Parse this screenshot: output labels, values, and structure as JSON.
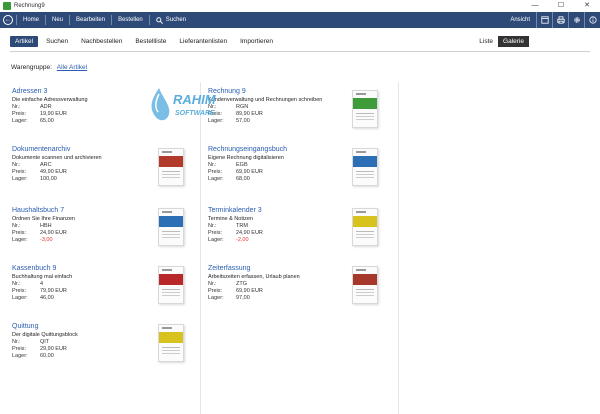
{
  "window": {
    "title": "Rechnung9",
    "controls": [
      "—",
      "☐",
      "✕"
    ]
  },
  "toolbar": {
    "items": [
      "Home",
      "Neu",
      "Bearbeiten",
      "Bestellen"
    ],
    "search_label": "Suchen",
    "view_label": "Ansicht"
  },
  "tabs": [
    "Artikel",
    "Suchen",
    "Nachbestellen",
    "Bestellliste",
    "Lieferantenlisten",
    "Importieren"
  ],
  "view": {
    "list": "Liste",
    "gallery": "Galerie"
  },
  "group": {
    "label": "Warengruppe:",
    "value": "Alle Artikel"
  },
  "watermark": {
    "text1": "RAHIM",
    "text2": "SOFTWARE"
  },
  "labels": {
    "nr": "Nr.:",
    "preis": "Preis:",
    "lager": "Lager:"
  },
  "products": [
    {
      "name": "Adressen 3",
      "desc": "Die einfache Adressverwaltung",
      "nr": "ADR",
      "preis": "19,90 EUR",
      "lager": "65,00",
      "neg": false,
      "color": ""
    },
    {
      "name": "Dokumentenarchiv",
      "desc": "Dokumente scannen und archivieren",
      "nr": "ARC",
      "preis": "49,90 EUR",
      "lager": "100,00",
      "neg": false,
      "color": "#b23a2a"
    },
    {
      "name": "Haushaltsbuch 7",
      "desc": "Ordnen Sie Ihre Finanzen",
      "nr": "HBH",
      "preis": "24,90 EUR",
      "lager": "-3,00",
      "neg": true,
      "color": "#2d6fb5"
    },
    {
      "name": "Kassenbuch 9",
      "desc": "Buchhaltung mal einfach",
      "nr": "4",
      "preis": "79,90 EUR",
      "lager": "46,00",
      "neg": false,
      "color": "#b8272a"
    },
    {
      "name": "Quittung",
      "desc": "Der digitale Quittungsblock",
      "nr": "QIT",
      "preis": "29,90 EUR",
      "lager": "60,00",
      "neg": false,
      "color": "#d8c21d"
    },
    {
      "name": "Rechnung 9",
      "desc": "Kundenverwaltung und Rechnungen schreiben",
      "nr": "RGN",
      "preis": "89,90 EUR",
      "lager": "57,00",
      "neg": false,
      "color": "#3d9b3a"
    },
    {
      "name": "Rechnungseingangsbuch",
      "desc": "Eigene Rechnung digitalisieren",
      "nr": "EGB",
      "preis": "69,90 EUR",
      "lager": "68,00",
      "neg": false,
      "color": "#2d6fb5"
    },
    {
      "name": "Terminkalender 3",
      "desc": "Termine & Notizen",
      "nr": "TRM",
      "preis": "24,90 EUR",
      "lager": "-2,00",
      "neg": true,
      "color": "#d8c21d"
    },
    {
      "name": "Zeiterfassung",
      "desc": "Arbeitszeiten erfassen, Urlaub planen",
      "nr": "ZTG",
      "preis": "69,90 EUR",
      "lager": "97,00",
      "neg": false,
      "color": "#a5382a"
    }
  ]
}
